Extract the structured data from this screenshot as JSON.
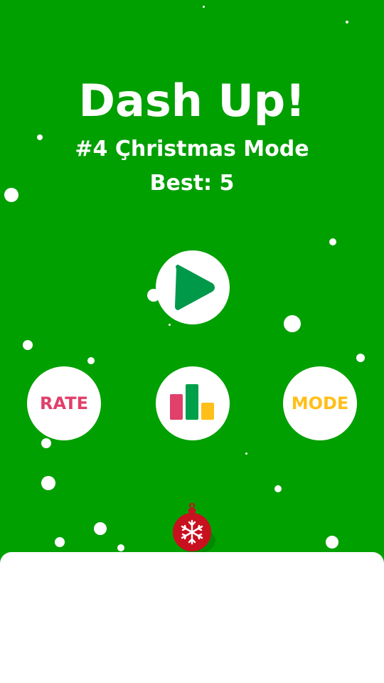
{
  "game": {
    "title": "Dash Up!",
    "mode_label": "#4 Çhristmas Mode",
    "best_label": "Best: 5"
  },
  "buttons": {
    "play_icon": "play-icon",
    "rate_label": "RATE",
    "leaderboard_icon": "bar-chart-icon",
    "mode_label": "MODE"
  },
  "player": {
    "icon": "snowflake-ornament-icon"
  },
  "colors": {
    "background": "#00a000",
    "play_green": "#00994a",
    "rate_pink": "#e0406a",
    "chart_green": "#00a04a",
    "mode_yellow": "#ffbf1a",
    "ornament_red": "#c8101e"
  }
}
